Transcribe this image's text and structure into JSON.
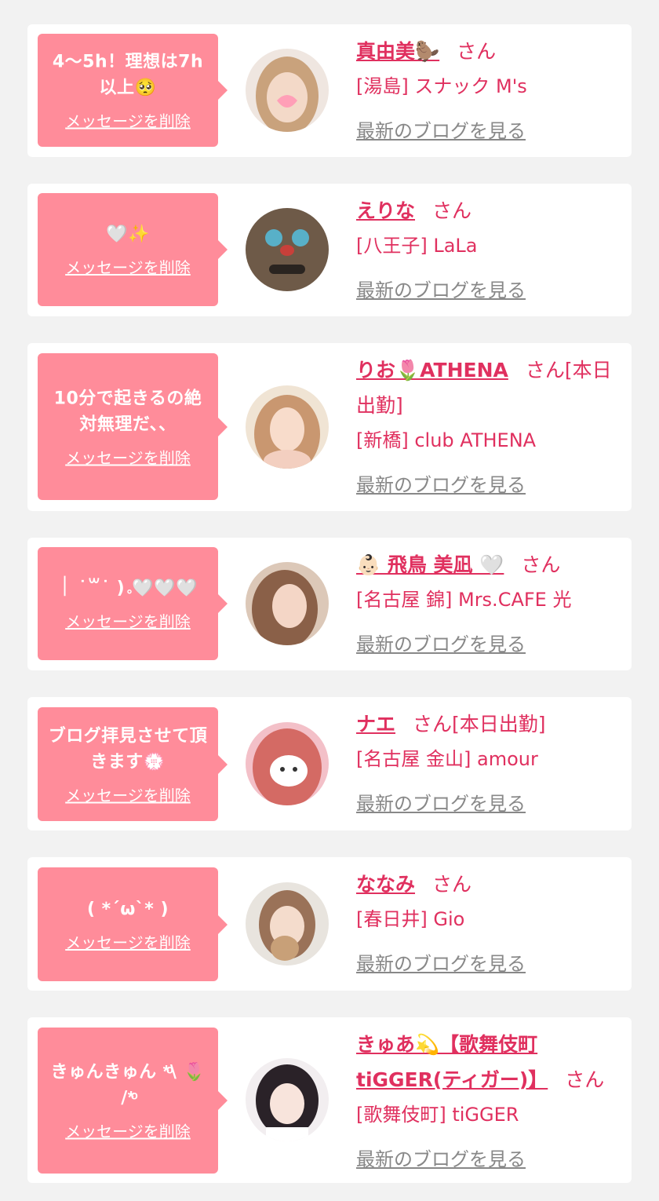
{
  "delete_label": "メッセージを削除",
  "blog_label": "最新のブログを見る",
  "colors": {
    "background": "#f2f2f2",
    "bubble": "#ff8c9a",
    "accent": "#e0305f",
    "link_gray": "#888888"
  },
  "cards": [
    {
      "message": "4〜5h！理想は7h以上🥺",
      "name": "真由美🦫",
      "honorific": "さん",
      "shop": "[湯島] スナック M's",
      "avatar_icon": "profile-photo"
    },
    {
      "message": "🤍✨",
      "name": "えりな",
      "honorific": "さん",
      "shop": "[八王子] LaLa",
      "avatar_icon": "profile-photo"
    },
    {
      "message": "10分で起きるの絶対無理だ、、",
      "name": "りお🌷ATHENA",
      "honorific": "さん[本日出勤]",
      "shop": "[新橋] club ATHENA",
      "avatar_icon": "profile-photo"
    },
    {
      "message": "｜ ˙꒳˙ )｡🤍🤍🤍",
      "name": "👶🏻 飛鳥 美凪 🤍",
      "honorific": "さん",
      "shop": "[名古屋 錦] Mrs.CAFE 光",
      "avatar_icon": "profile-photo"
    },
    {
      "message": "ブログ拝見させて頂きます💮",
      "name": "ナエ",
      "honorific": "さん[本日出勤]",
      "shop": "[名古屋 金山] amour",
      "avatar_icon": "profile-photo"
    },
    {
      "message": "( *´ω`* )",
      "name": "ななみ",
      "honorific": "さん",
      "shop": "[春日井] Gio",
      "avatar_icon": "profile-photo"
    },
    {
      "message": "きゅんきゅん *ͦ\\ 🌷 /*ͦ",
      "name": "きゅあ💫【歌舞伎町tiGGER(ティガー)】",
      "honorific": "さん",
      "shop": "[歌舞伎町] tiGGER",
      "avatar_icon": "profile-photo"
    }
  ]
}
